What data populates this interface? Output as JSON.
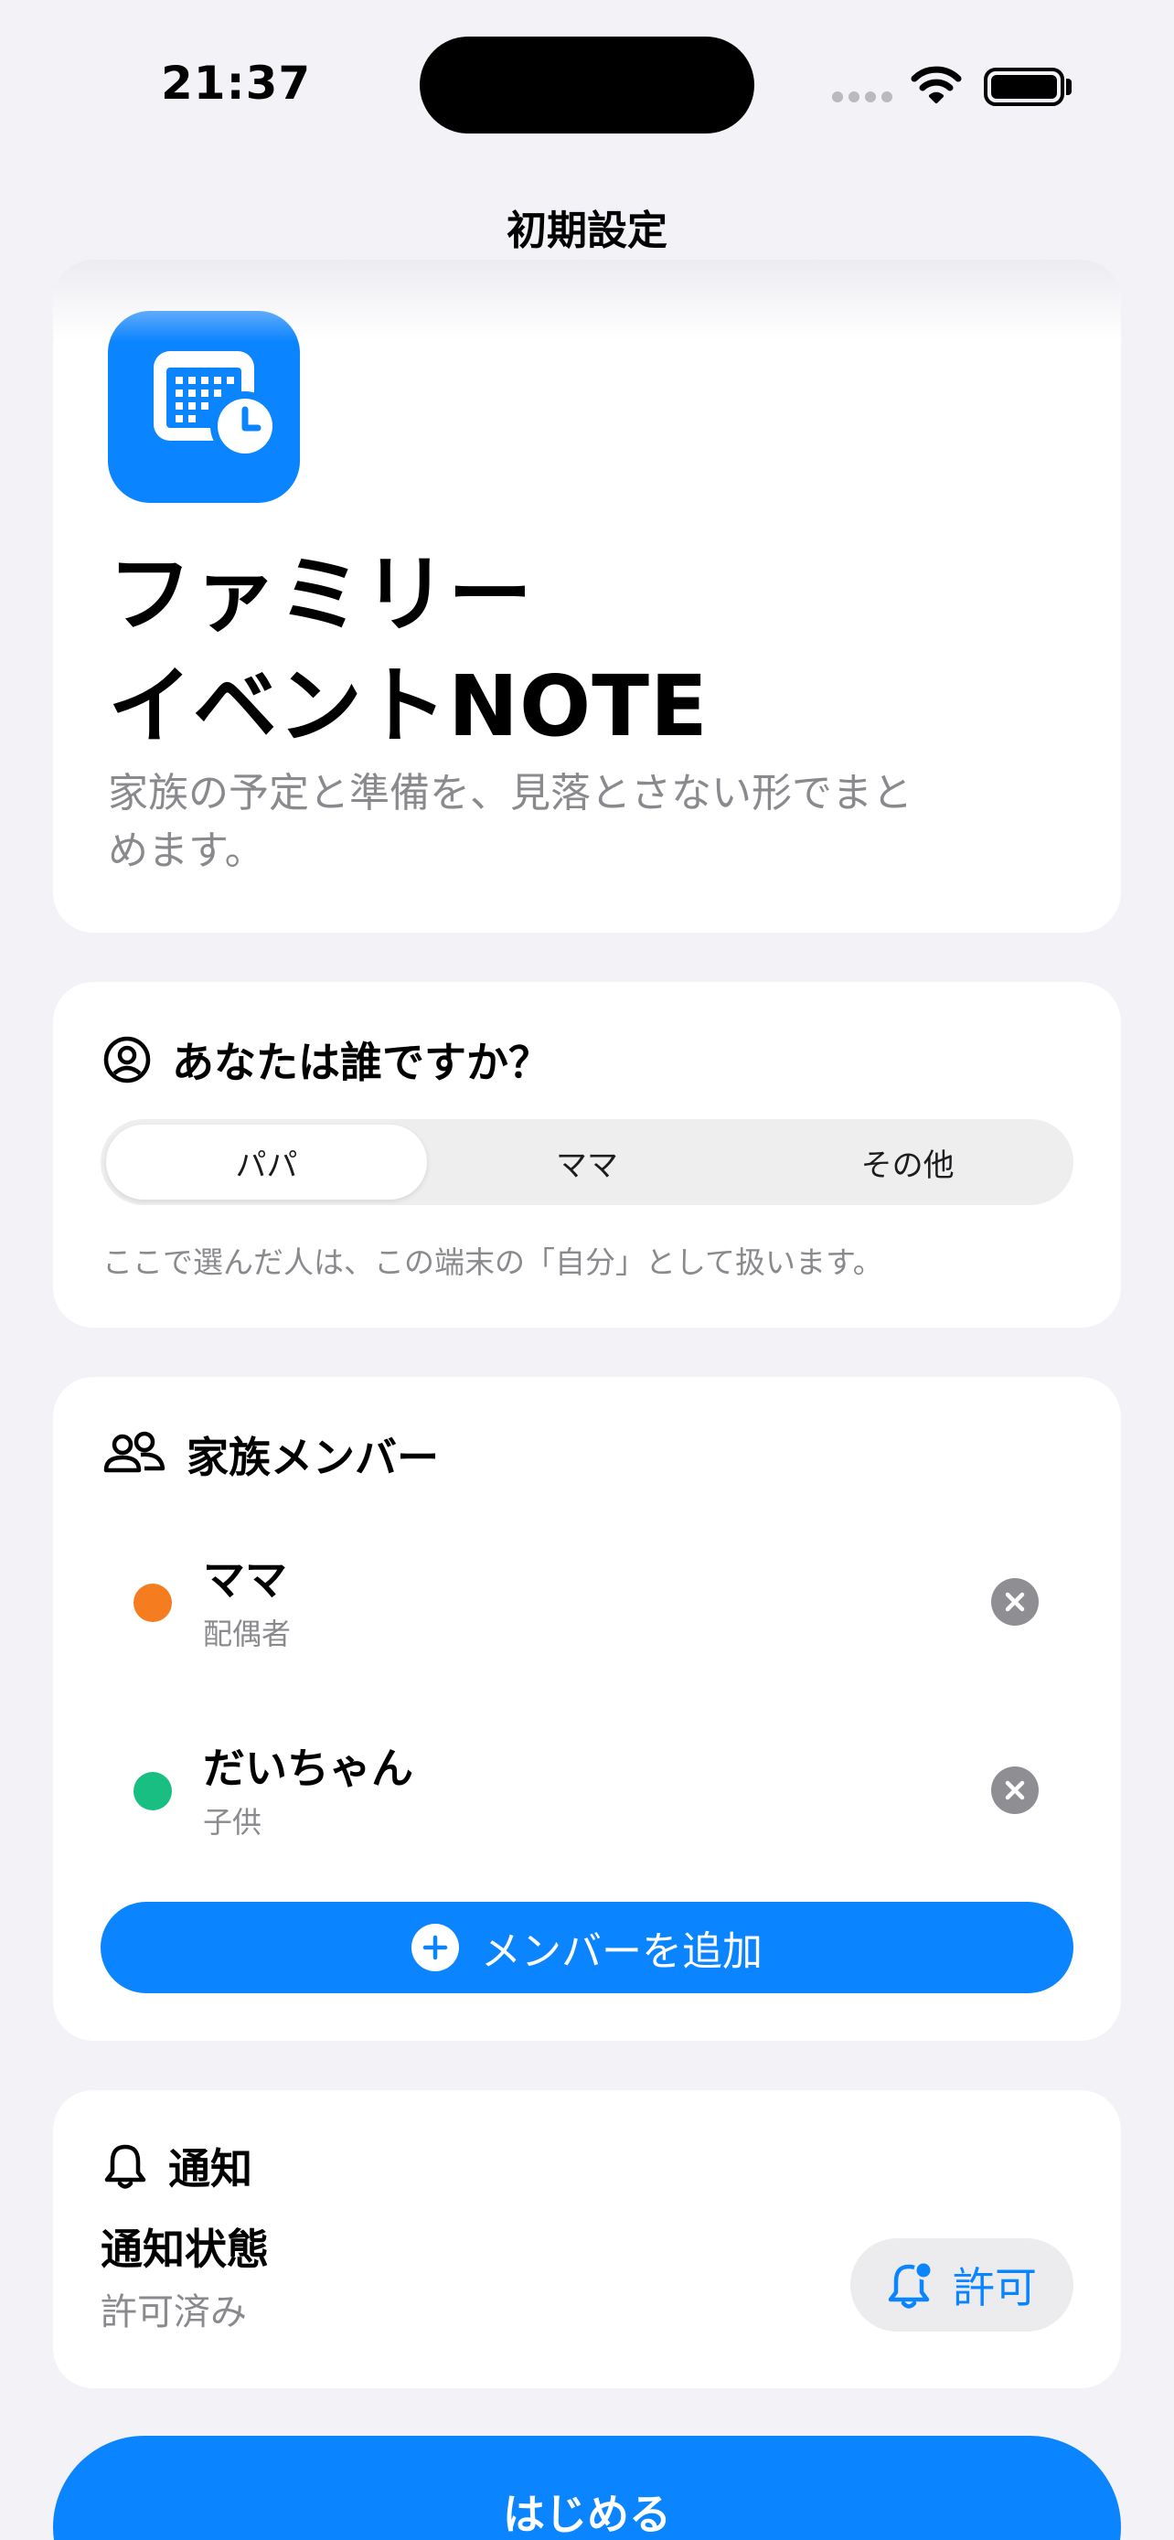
{
  "status_bar": {
    "time": "21:37"
  },
  "nav": {
    "title": "初期設定"
  },
  "hero": {
    "icon": "calendar-clock-icon",
    "title_line1": "ファミリー",
    "title_line2": "イベントNOTE",
    "description": "家族の予定と準備を、見落とさない形でまとめます。"
  },
  "who": {
    "title": "あなたは誰ですか？",
    "icon": "person-circle-icon",
    "options": [
      "パパ",
      "ママ",
      "その他"
    ],
    "selected": "パパ",
    "hint": "ここで選んだ人は、この端末の「自分」として扱います。"
  },
  "members": {
    "title": "家族メンバー",
    "icon": "people-icon",
    "items": [
      {
        "name": "ママ",
        "role": "配偶者",
        "color": "#F57C1F"
      },
      {
        "name": "だいちゃん",
        "role": "子供",
        "color": "#19BE82"
      }
    ],
    "add_label": "メンバーを追加"
  },
  "notifications": {
    "title": "通知",
    "icon": "bell-icon",
    "status_label": "通知状態",
    "status_value": "許可済み",
    "allow_label": "許可"
  },
  "start_label": "はじめる",
  "colors": {
    "accent": "#0A84FF",
    "background": "#F2F2F7"
  }
}
